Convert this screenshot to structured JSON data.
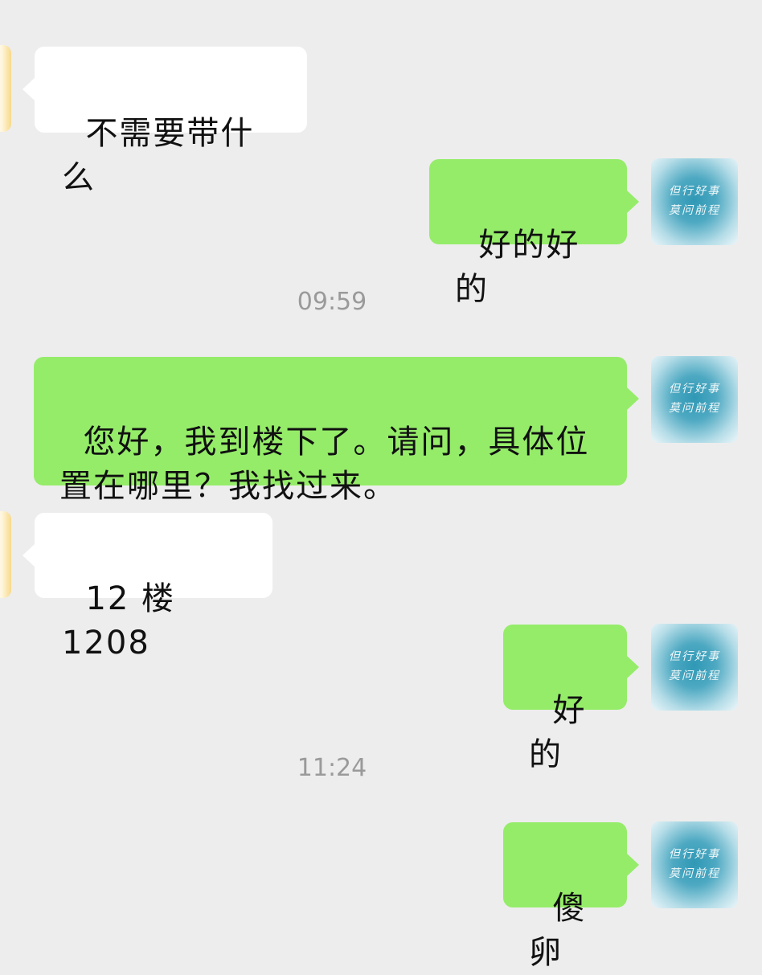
{
  "chat": {
    "timestamps": [
      "09:59",
      "11:24"
    ],
    "messages": [
      {
        "side": "in",
        "text": "不需要带什么"
      },
      {
        "side": "out",
        "text": "好的好的"
      },
      {
        "side": "out",
        "text": "您好，我到楼下了。请问，具体位\n置在哪里？我找过来。"
      },
      {
        "side": "in",
        "text": "12 楼 1208"
      },
      {
        "side": "out",
        "text": "好的"
      },
      {
        "side": "out",
        "text": "傻卵"
      }
    ]
  },
  "avatar": {
    "calligraphy_line1": "但行好事",
    "calligraphy_line2": "莫问前程"
  },
  "colors": {
    "background": "#ededed",
    "incoming_bubble": "#ffffff",
    "outgoing_bubble": "#95ec69",
    "timestamp_text": "#9a9a9a"
  }
}
